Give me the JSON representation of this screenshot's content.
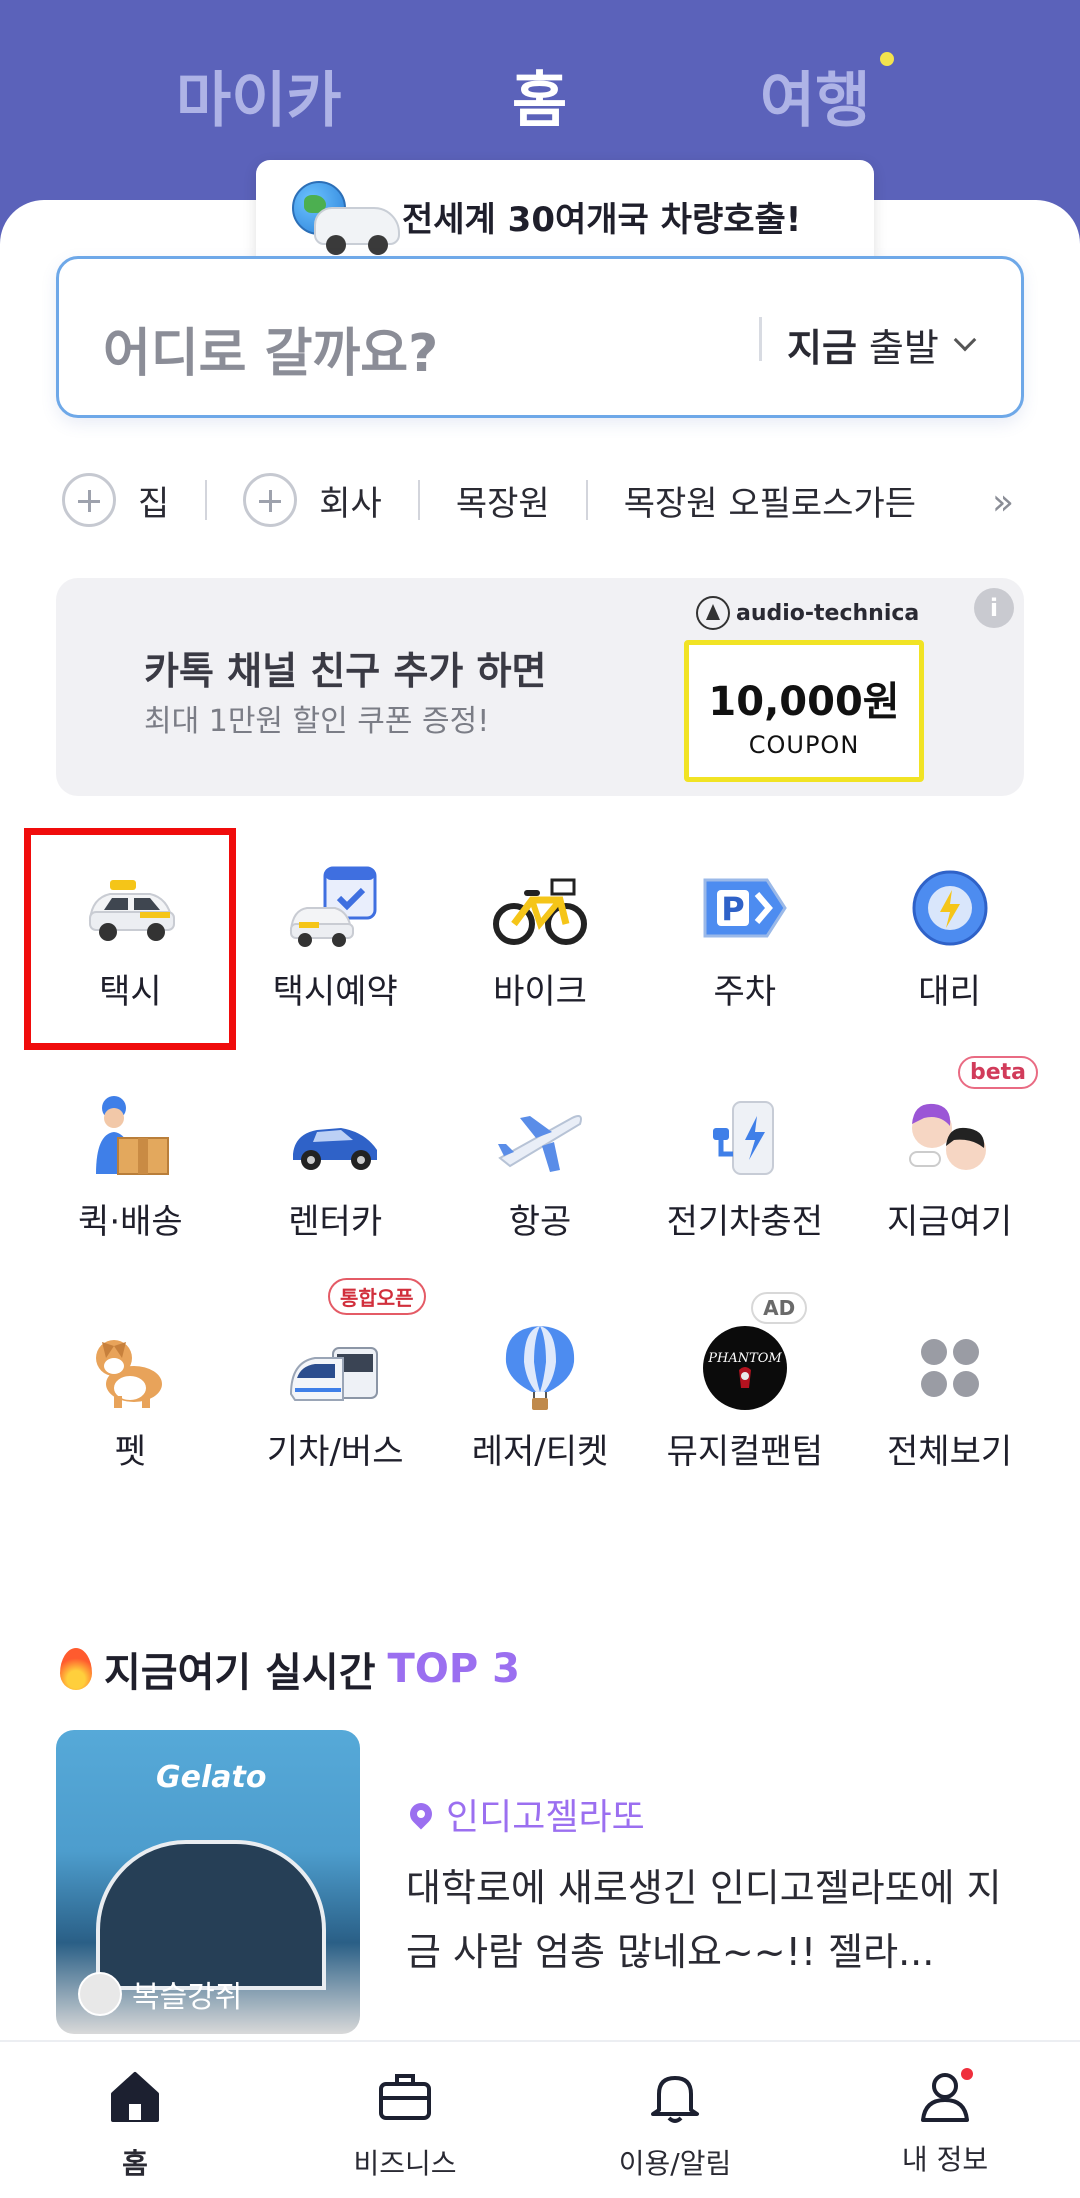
{
  "top_tabs": {
    "mycar": "마이카",
    "home": "홈",
    "travel": "여행"
  },
  "promo": {
    "text": "전세계 30여개국 차량호출!"
  },
  "search": {
    "placeholder": "어디로 갈까요?",
    "depart_bold": "지금",
    "depart_text": "출발"
  },
  "quick_places": [
    {
      "label": "집"
    },
    {
      "label": "회사"
    },
    {
      "label": "목장원"
    },
    {
      "label": "목장원 오필로스가든"
    }
  ],
  "ad": {
    "brand": "audio-technica",
    "title": "카톡 채널 친구 추가 하면",
    "subtitle": "최대 1만원 할인 쿠폰 증정!",
    "coupon_amount": "10,000원",
    "coupon_label": "COUPON",
    "info": "i"
  },
  "services": [
    {
      "label": "택시",
      "icon": "taxi-icon"
    },
    {
      "label": "택시예약",
      "icon": "taxi-reservation-icon"
    },
    {
      "label": "바이크",
      "icon": "bike-icon"
    },
    {
      "label": "주차",
      "icon": "parking-icon"
    },
    {
      "label": "대리",
      "icon": "designated-driver-icon"
    },
    {
      "label": "퀵·배송",
      "icon": "delivery-icon"
    },
    {
      "label": "렌터카",
      "icon": "rental-car-icon"
    },
    {
      "label": "항공",
      "icon": "airplane-icon"
    },
    {
      "label": "전기차충전",
      "icon": "ev-charging-icon"
    },
    {
      "label": "지금여기",
      "icon": "now-here-icon",
      "badge": "beta"
    },
    {
      "label": "펫",
      "icon": "pet-icon"
    },
    {
      "label": "기차/버스",
      "icon": "train-bus-icon",
      "badge": "통합오픈"
    },
    {
      "label": "레저/티켓",
      "icon": "balloon-icon"
    },
    {
      "label": "뮤지컬팬텀",
      "icon": "phantom-icon",
      "badge": "AD"
    },
    {
      "label": "전체보기",
      "icon": "all-services-icon"
    }
  ],
  "section": {
    "title": "지금여기 실시간",
    "accent": "TOP 3"
  },
  "card": {
    "thumb_sign": "Gelato",
    "user": "복슬강쥐",
    "location": "인디고젤라또",
    "text": "대학로에 새로생긴 인디고젤라또에 지금 사람 엄총 많네요~~!! 젤라..."
  },
  "bottom_nav": [
    {
      "label": "홈",
      "icon": "home-icon",
      "active": true
    },
    {
      "label": "비즈니스",
      "icon": "briefcase-icon"
    },
    {
      "label": "이용/알림",
      "icon": "bell-icon"
    },
    {
      "label": "내 정보",
      "icon": "user-icon"
    }
  ],
  "colors": {
    "header_bg": "#5b62ba",
    "accent_purple": "#9b6ff0",
    "highlight_red": "#f00c0c",
    "coupon_yellow": "#f1e324"
  }
}
